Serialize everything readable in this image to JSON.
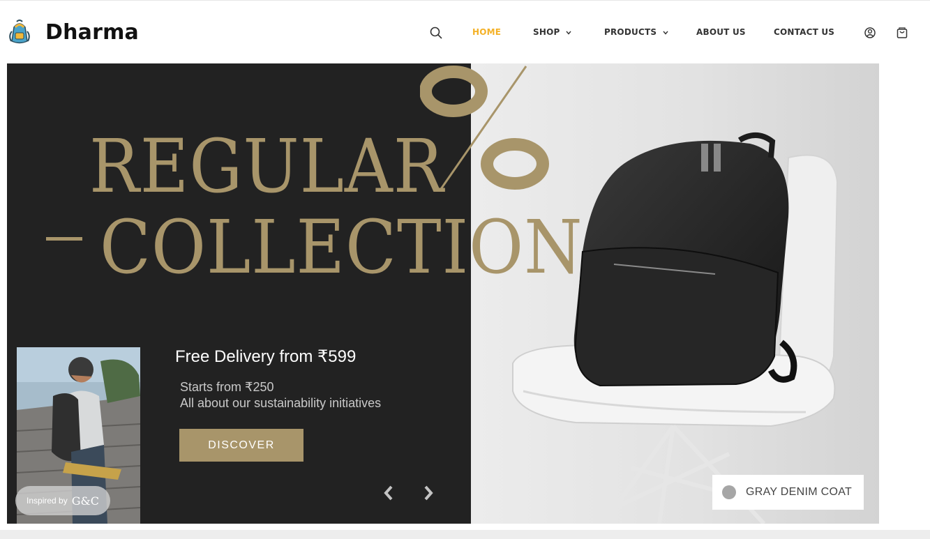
{
  "header": {
    "brand": "Dharma",
    "nav": [
      {
        "label": "HOME",
        "active": true
      },
      {
        "label": "SHOP",
        "has_dropdown": true
      },
      {
        "label": "PRODUCTS",
        "has_dropdown": true
      },
      {
        "label": "ABOUT US"
      },
      {
        "label": "CONTACT US"
      }
    ],
    "icons": [
      "search-icon",
      "account-icon",
      "cart-icon"
    ],
    "accent_color": "#f4b126"
  },
  "hero": {
    "headline_line1": "REGULAR",
    "headline_line2": "COLLECTION",
    "promo_title": "Free Delivery from ₹599",
    "promo_line1": "Starts from ₹250",
    "promo_line2": "All about our sustainability initiatives",
    "cta_label": "DISCOVER",
    "badge_prefix": "Inspired by",
    "badge_brand": "G&C",
    "product_tag": "GRAY DENIM COAT",
    "colors": {
      "dark_panel": "#222222",
      "gold": "#a8956a"
    }
  }
}
